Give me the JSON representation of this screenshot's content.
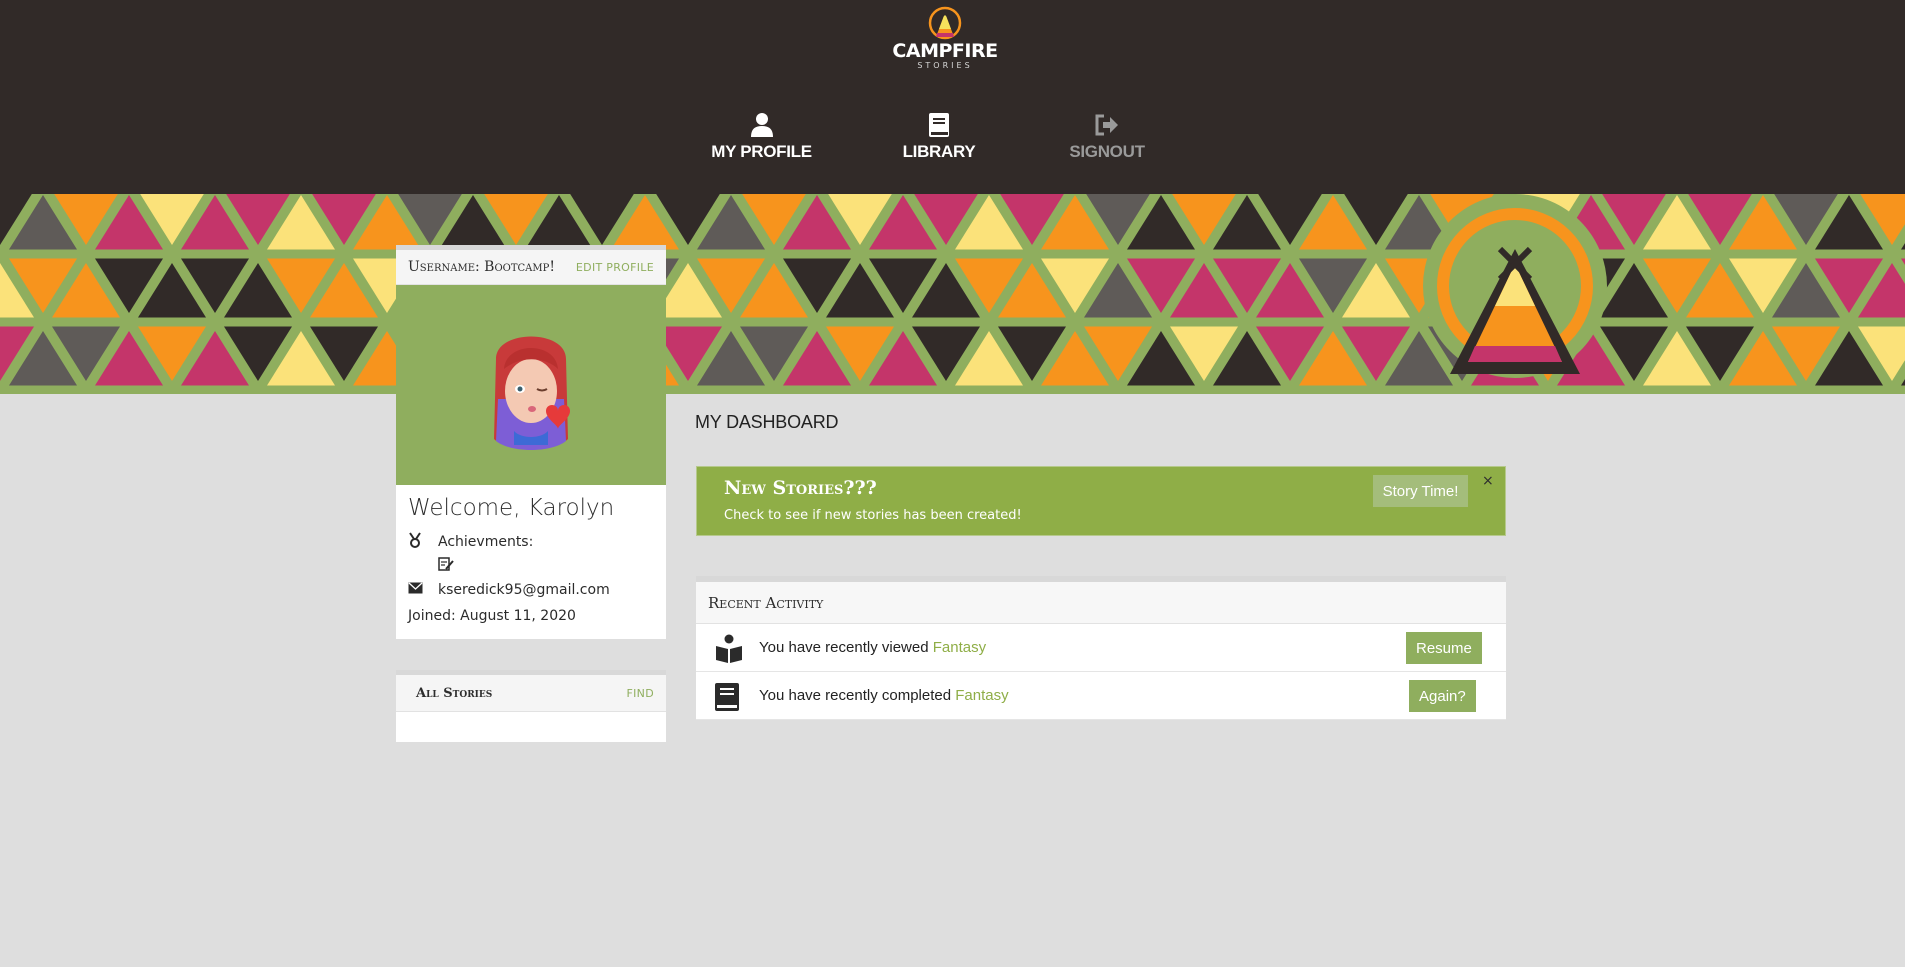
{
  "header": {
    "logo_text": "CAMPFIRE",
    "logo_sub": "STORIES",
    "nav": {
      "profile": "MY PROFILE",
      "library": "LIBRARY",
      "signout": "SIGNOUT"
    }
  },
  "profile": {
    "username_label": "Username: Bootcamp!",
    "edit_label": "EDIT PROFILE",
    "welcome": "Welcome, Karolyn",
    "achievements_label": "Achievments:",
    "email": "kseredick95@gmail.com",
    "joined": "Joined: August 11, 2020"
  },
  "stories": {
    "title": "All Stories",
    "find_label": "FIND"
  },
  "dashboard": {
    "title": "MY DASHBOARD",
    "alert": {
      "title": "New Stories???",
      "body": "Check to see if new stories has been created!",
      "button": "Story Time!",
      "close": "×"
    },
    "activity": {
      "title": "Recent Activity",
      "rows": [
        {
          "prefix": "You have recently viewed ",
          "link": "Fantasy",
          "button": "Resume",
          "icon": "book-reader-icon"
        },
        {
          "prefix": "You have recently completed ",
          "link": "Fantasy",
          "button": "Again?",
          "icon": "book-icon"
        }
      ]
    }
  },
  "colors": {
    "header_bg": "#312a28",
    "accent_green": "#8fae5e",
    "page_bg": "#dedede"
  }
}
